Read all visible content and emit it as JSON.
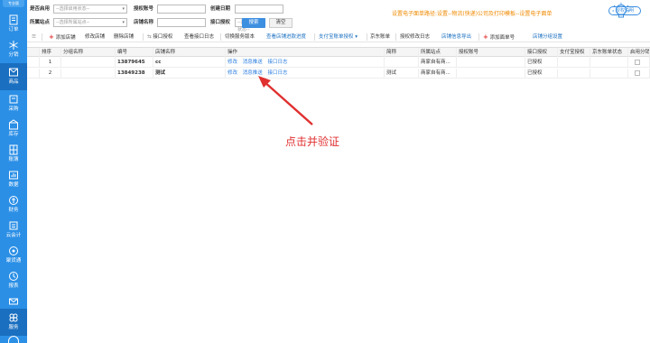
{
  "sidebar": {
    "version": "专业版",
    "items": [
      {
        "label": "订单",
        "icon": "order-icon"
      },
      {
        "label": "分销",
        "icon": "distribution-icon"
      },
      {
        "label": "商品",
        "icon": "product-icon"
      },
      {
        "label": "采购",
        "icon": "purchase-icon"
      },
      {
        "label": "库存",
        "icon": "inventory-icon"
      },
      {
        "label": "账簿",
        "icon": "ledger-icon"
      },
      {
        "label": "数据",
        "icon": "data-icon"
      },
      {
        "label": "财务",
        "icon": "finance-icon"
      },
      {
        "label": "云会计",
        "icon": "cloud-accounting-icon"
      },
      {
        "label": "聚货通",
        "icon": "juhuotong-icon"
      },
      {
        "label": "报表",
        "icon": "report-icon"
      },
      {
        "label": "",
        "icon": "mail-icon"
      },
      {
        "label": "服务",
        "icon": "service-icon"
      }
    ]
  },
  "filters": {
    "enabled_label": "是否启用",
    "enabled_placeholder": "--选择启用状态--",
    "auth_account_label": "授权账号",
    "create_date_label": "创建日期",
    "site_label": "所属站点",
    "site_placeholder": "--选择所属站点--",
    "shop_name_label": "店铺名称",
    "api_auth_label": "接口授权",
    "api_auth_placeholder": "--选择授权状态--",
    "search_button": "搜索",
    "clear_button": "清空"
  },
  "tip": "设置电子面单路径:设置--物流(快递)公司及打印模板--设置电子面单",
  "auth_help": "授权说明",
  "toolbar": {
    "add_shop": "添加店铺",
    "edit_shop": "修改店铺",
    "delete_shop": "删除店铺",
    "api_auth": "接口授权",
    "view_api_log": "查看接口日志",
    "switch_version": "切换服务版本",
    "view_shop_fee": "查看店铺进款进度",
    "alipay_auth": "支付宝账单授权",
    "jd_bill": "京东账单",
    "auth_change_log": "授权修改日志",
    "shop_info_export": "店铺信息导出",
    "add_waybill": "添加面单号",
    "shop_group_settings": "店铺分组设置"
  },
  "table": {
    "headers": [
      "排序",
      "分组名称",
      "编号",
      "店铺名称",
      "操作",
      "简称",
      "所属站点",
      "授权账号",
      "接口授权",
      "支付宝授权",
      "京东账单状态",
      "启用分销"
    ],
    "rows": [
      {
        "index": "1",
        "group": "",
        "code": "13879645",
        "name": "cc",
        "actions": [
          "修改",
          "消息推送",
          "接口日志"
        ],
        "short": "",
        "site": "商家自有商...",
        "account": "",
        "api_auth": "已授权"
      },
      {
        "index": "2",
        "group": "",
        "code": "13849238",
        "name": "测试",
        "actions": [
          "修改",
          "消息推送",
          "接口日志"
        ],
        "short": "测试",
        "site": "商家自有商...",
        "account": "",
        "api_auth": "已授权"
      }
    ]
  },
  "annotation": {
    "text": "点击并验证",
    "color": "#e03030"
  },
  "colors": {
    "sidebar": "#2b8fe6",
    "link": "#2a7ee0",
    "tip": "#f08a00"
  }
}
